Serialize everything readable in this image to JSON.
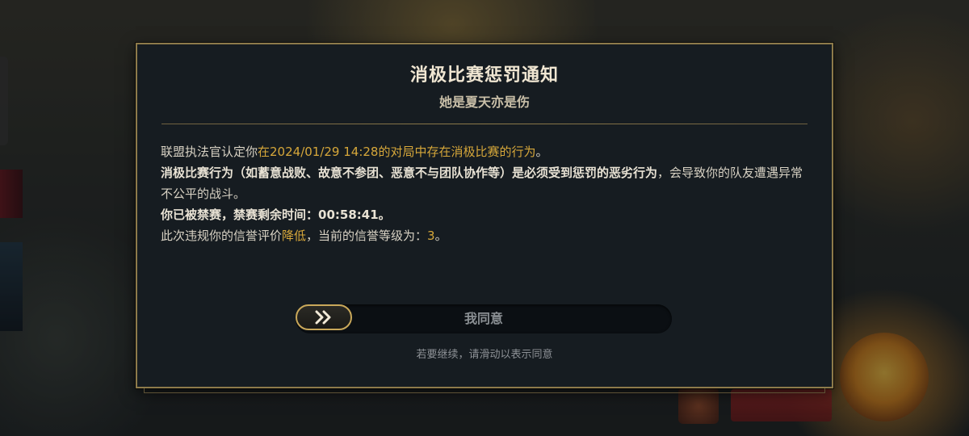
{
  "dialog": {
    "title": "消极比赛惩罚通知",
    "player_name": "她是夏天亦是伤",
    "lines": {
      "line1_prefix": "联盟执法官认定你",
      "line1_highlight": "在2024/01/29 14:28的对局中存在消极比赛的行为",
      "line1_suffix": "。",
      "line2_bold": "消极比赛行为（如蓄意战败、故意不参团、恶意不与团队协作等）是必须受到惩罚的恶劣行为",
      "line2_rest": "，会导致你的队友遭遇异常不公平的战斗。",
      "ban_label": "你已被禁赛，禁赛剩余时间：",
      "ban_time": "00:58:41",
      "ban_suffix": "。",
      "credit_prefix": "此次违规你的信誉评价",
      "credit_change": "降低",
      "credit_middle": "，当前的信誉等级为：",
      "credit_level": "3",
      "credit_suffix": "。"
    },
    "slider": {
      "label": "我同意",
      "handle_icon": "double-chevron-right-icon",
      "progress": 0
    },
    "hint": "若要继续，请滑动以表示同意"
  },
  "colors": {
    "accent_gold": "#d6a73a",
    "border_gold": "#8d7a4a",
    "dialog_bg": "#161c21"
  }
}
